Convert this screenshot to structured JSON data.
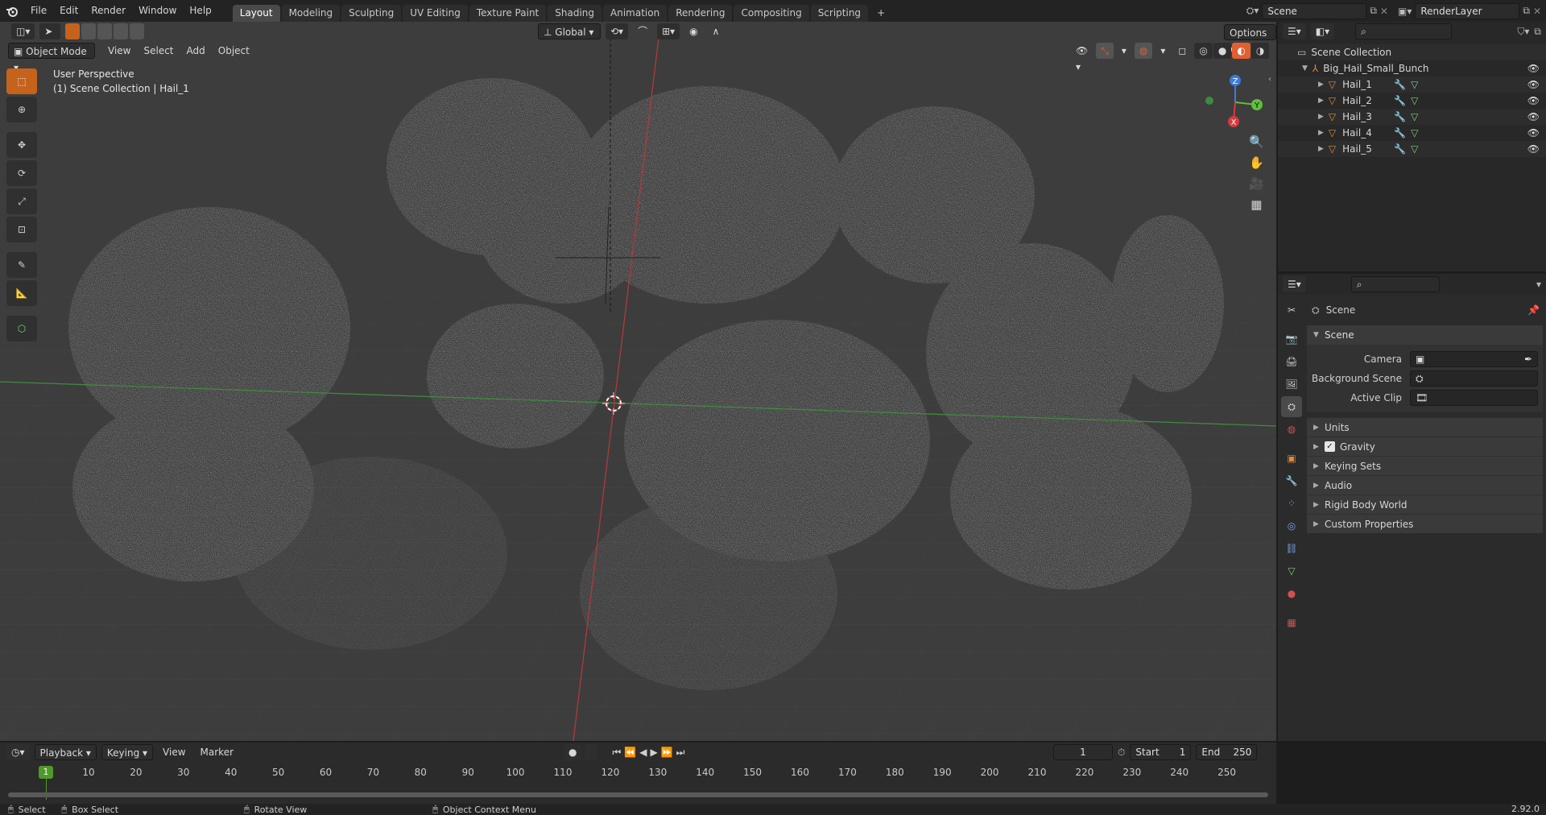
{
  "menu": [
    "File",
    "Edit",
    "Render",
    "Window",
    "Help"
  ],
  "workspaces": [
    "Layout",
    "Modeling",
    "Sculpting",
    "UV Editing",
    "Texture Paint",
    "Shading",
    "Animation",
    "Rendering",
    "Compositing",
    "Scripting"
  ],
  "active_workspace": "Layout",
  "scene_field": "Scene",
  "renderlayer_field": "RenderLayer",
  "viewport": {
    "mode": "Object Mode",
    "menus": [
      "View",
      "Select",
      "Add",
      "Object"
    ],
    "transform_orientation": "Global",
    "options_label": "Options",
    "overlay_title": "User Perspective",
    "overlay_subtitle": "(1) Scene Collection | Hail_1",
    "gizmo": {
      "x": "X",
      "y": "Y",
      "z": "Z"
    }
  },
  "outliner": {
    "root": "Scene Collection",
    "collection": "Big_Hail_Small_Bunch",
    "objects": [
      "Hail_1",
      "Hail_2",
      "Hail_3",
      "Hail_4",
      "Hail_5"
    ]
  },
  "properties": {
    "context": "Scene",
    "panel": "Scene",
    "fields": {
      "camera": "Camera",
      "background_scene": "Background Scene",
      "active_clip": "Active Clip"
    },
    "subpanels": [
      "Units",
      "Gravity",
      "Keying Sets",
      "Audio",
      "Rigid Body World",
      "Custom Properties"
    ],
    "gravity_checked": true
  },
  "timeline": {
    "menus": [
      "Playback",
      "Keying",
      "View",
      "Marker"
    ],
    "current_frame": "1",
    "start_label": "Start",
    "start": "1",
    "end_label": "End",
    "end": "250",
    "ticks": [
      "10",
      "20",
      "30",
      "40",
      "50",
      "60",
      "70",
      "80",
      "90",
      "100",
      "110",
      "120",
      "130",
      "140",
      "150",
      "160",
      "170",
      "180",
      "190",
      "200",
      "210",
      "220",
      "230",
      "240",
      "250"
    ],
    "playhead": "1"
  },
  "status": {
    "select": "Select",
    "box_select": "Box Select",
    "rotate": "Rotate View",
    "context_menu": "Object Context Menu",
    "version": "2.92.0"
  },
  "colors": {
    "accent": "#c5621c",
    "x_axis": "#d93a3a",
    "y_axis": "#5fbf3a",
    "z_axis": "#3a7bd9",
    "timeline_head": "#4e9a2a"
  }
}
